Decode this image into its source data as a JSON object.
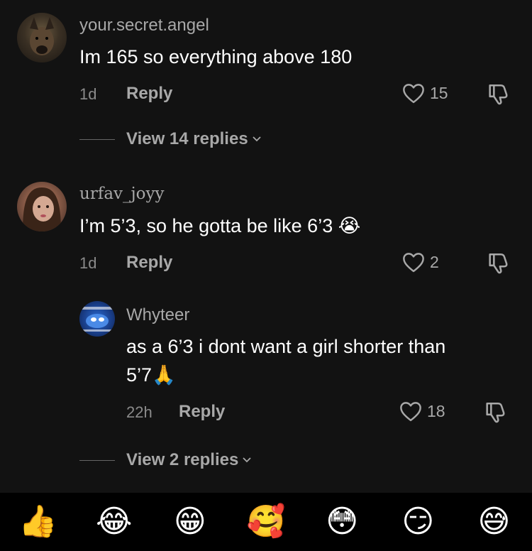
{
  "comments": [
    {
      "username": "your.secret.angel",
      "text": "Im 165 so everything above 180",
      "time": "1d",
      "reply_label": "Reply",
      "likes": "15",
      "view_replies": "View 14 replies"
    },
    {
      "username": "urfav_joyy",
      "text": "I’m 5’3, so he gotta be like 6’3 😭",
      "time": "1d",
      "reply_label": "Reply",
      "likes": "2"
    },
    {
      "username": "Whyteer",
      "text_line1": "as a 6’3 i dont want a girl shorter than",
      "text_line2": "5’7🙏",
      "time": "22h",
      "reply_label": "Reply",
      "likes": "18",
      "view_replies": "View 2 replies"
    }
  ],
  "emoji_bar": [
    "👍",
    "😂",
    "😁",
    "🥰",
    "😳",
    "😏",
    "😅"
  ],
  "colors": {
    "background": "#121212",
    "muted": "#a8a8a8",
    "bar": "#000000"
  }
}
